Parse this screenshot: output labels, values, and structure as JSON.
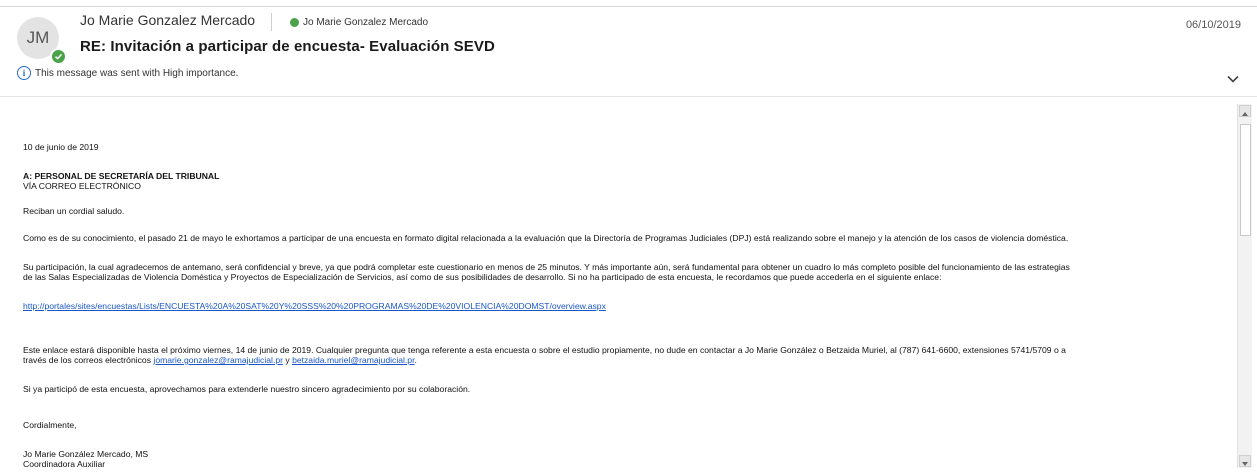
{
  "header": {
    "avatar_initials": "JM",
    "from_name": "Jo Marie Gonzalez Mercado",
    "to_name": "Jo Marie Gonzalez Mercado",
    "date": "06/10/2019",
    "subject": "RE: Invitación a participar de encuesta- Evaluación SEVD",
    "importance_text": "This message was sent with High importance.",
    "presence_color": "#4aa34a"
  },
  "body": {
    "date_line": "10 de junio de 2019",
    "to_line": "A: PERSONAL DE SECRETARÍA DEL TRIBUNAL",
    "via_line": "VÍA CORREO ELECTRÓNICO",
    "greeting": "Reciban un cordial saludo.",
    "para1": "Como es de su conocimiento, el pasado 21 de mayo le exhortamos a participar de una encuesta en formato digital relacionada a la evaluación que la Directoría de Programas Judiciales (DPJ) está realizando sobre el manejo y la atención de los casos de violencia doméstica.",
    "para2_line1": "Su participación, la cual agradecemos de antemano, será confidencial y breve, ya que podrá completar este cuestionario en menos de 25 minutos. Y más importante aún, será fundamental para obtener un cuadro lo más completo posible del funcionamiento de las estrategias",
    "para2_line2": "de las Salas Especializadas de Violencia Doméstica y Proyectos de Especialización de Servicios, así como de sus posibilidades de desarrollo. Si no ha participado de esta encuesta, le recordamos que puede accederla en el siguiente enlace:",
    "survey_link": "http://portales/sites/encuestas/Lists/ENCUESTA%20A%20SAT%20Y%20SSS%20%20PROGRAMAS%20DE%20VIOLENCIA%20DOMST/overview.aspx",
    "para3_line1": "Este enlace estará disponible hasta el próximo viernes, 14 de junio de 2019. Cualquier pregunta que tenga referente a esta encuesta o sobre el estudio propiamente, no dude en contactar a Jo Marie González o Betzaida Muriel, al (787) 641-6600, extensiones 5741/5709 o a",
    "para3_line2_prefix": "través de los correos electrónicos ",
    "email1": "jomarie.gonzalez@ramajudicial.pr",
    "para3_and": " y ",
    "email2": "betzaida.muriel@ramajudicial.pr",
    "para3_end": ".",
    "para4": "Si ya participó de esta encuesta, aprovechamos para extenderle nuestro sincero agradecimiento por su colaboración.",
    "closing": "Cordialmente,",
    "sig_name": "Jo Marie González Mercado, MS",
    "sig_title": "Coordinadora Auxiliar"
  }
}
